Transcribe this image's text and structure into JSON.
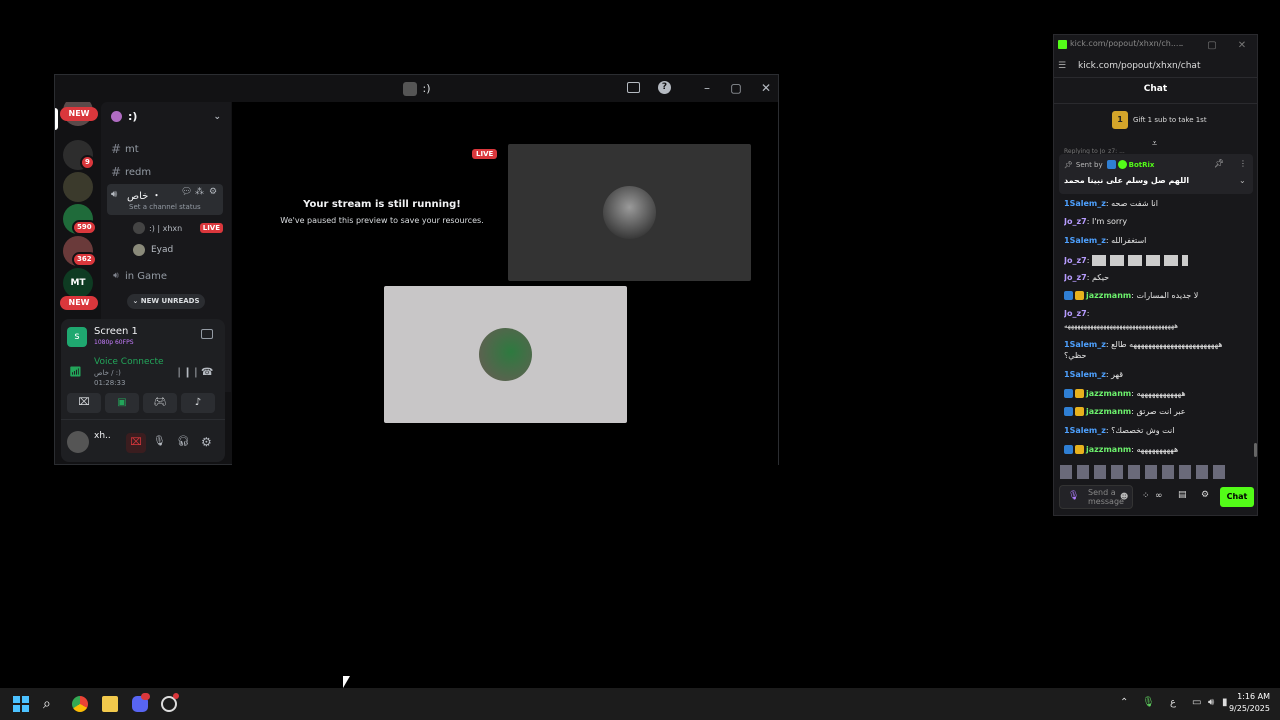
{
  "discord": {
    "window_title": ":)",
    "server_name": ":)",
    "guilds": {
      "new_top": "NEW",
      "new_bottom": "NEW",
      "badge_a": "9",
      "badge_b": "590",
      "badge_c": "362",
      "mt_label": "MT"
    },
    "channels": [
      {
        "name": "mt"
      },
      {
        "name": "redm"
      }
    ],
    "voice_channel": {
      "name": "خاص ・",
      "status_placeholder": "Set a channel status"
    },
    "voice_members": [
      {
        "name": ":) | xhxn",
        "badge": "LIVE"
      },
      {
        "name": "Eyad"
      }
    ],
    "in_game_channel": "in Game",
    "new_unreads": "NEW UNREADS",
    "screen_share": {
      "title": "Screen 1",
      "quality": "1080p 60FPS"
    },
    "voice": {
      "status": "Voice Connecte",
      "channel": "خاص / :)",
      "timer": "01:28:33"
    },
    "user": {
      "name": "xh.."
    },
    "stream": {
      "live_badge": "LIVE",
      "paused_title": "Your stream is still running!",
      "paused_subtitle": "We've paused this preview to save your resources."
    }
  },
  "kick": {
    "window_title": "kick.com/popout/xhxn/ch...",
    "url": "kick.com/popout/xhxn/chat",
    "header": "Chat",
    "gift_rank": "1",
    "gift_text": "Gift 1 sub to take 1st",
    "reply_preview": "Replying to Jo_z7: ...",
    "pinned": {
      "sent_by": "Sent by",
      "sender": "BotRix",
      "text": "اللهم صل وسلم على نبينا محمد"
    },
    "messages": [
      {
        "user": "1Salem_z",
        "cls": "u-salem",
        "text": "انا شفت صحه",
        "badge": false
      },
      {
        "user": "Jo_z7",
        "cls": "u-jo",
        "text": "I'm sorry",
        "badge": false
      },
      {
        "user": "1Salem_z",
        "cls": "u-salem",
        "text": "استغفرالله",
        "badge": false
      },
      {
        "user": "Jo_z7",
        "cls": "u-jo",
        "text": "[emotes]",
        "badge": false
      },
      {
        "user": "Jo_z7",
        "cls": "u-jo",
        "text": "حيكم",
        "badge": false
      },
      {
        "user": "jazzmanm",
        "cls": "u-jazz",
        "text": "لا جديده المسارات",
        "badge": true
      },
      {
        "user": "Jo_z7",
        "cls": "u-jo",
        "text": "",
        "badge": false
      },
      {
        "user": "",
        "cls": "",
        "text": "ههههههههههههههههههههههههههههههههههه",
        "badge": false
      },
      {
        "user": "1Salem_z",
        "cls": "u-salem",
        "text": "ههههههههههههههههههههههههه طالع",
        "badge": false
      },
      {
        "user": "",
        "cls": "",
        "text": "حظي؟",
        "badge": false
      },
      {
        "user": "1Salem_z",
        "cls": "u-salem",
        "text": "قهر",
        "badge": false
      },
      {
        "user": "jazzmanm",
        "cls": "u-jazz",
        "text": "ههههههههههههه",
        "badge": true
      },
      {
        "user": "jazzmanm",
        "cls": "u-jazz",
        "text": "عبر انت صرتق",
        "badge": true
      },
      {
        "user": "1Salem_z",
        "cls": "u-salem",
        "text": "انت وش تخصصك؟",
        "badge": false
      },
      {
        "user": "jazzmanm",
        "cls": "u-jazz",
        "text": "ههههههههههه",
        "badge": true
      }
    ],
    "input_placeholder": "Send a message",
    "chat_button": "Chat"
  },
  "taskbar": {
    "time": "1:16 AM",
    "date": "9/25/2025",
    "lang": "ع"
  }
}
